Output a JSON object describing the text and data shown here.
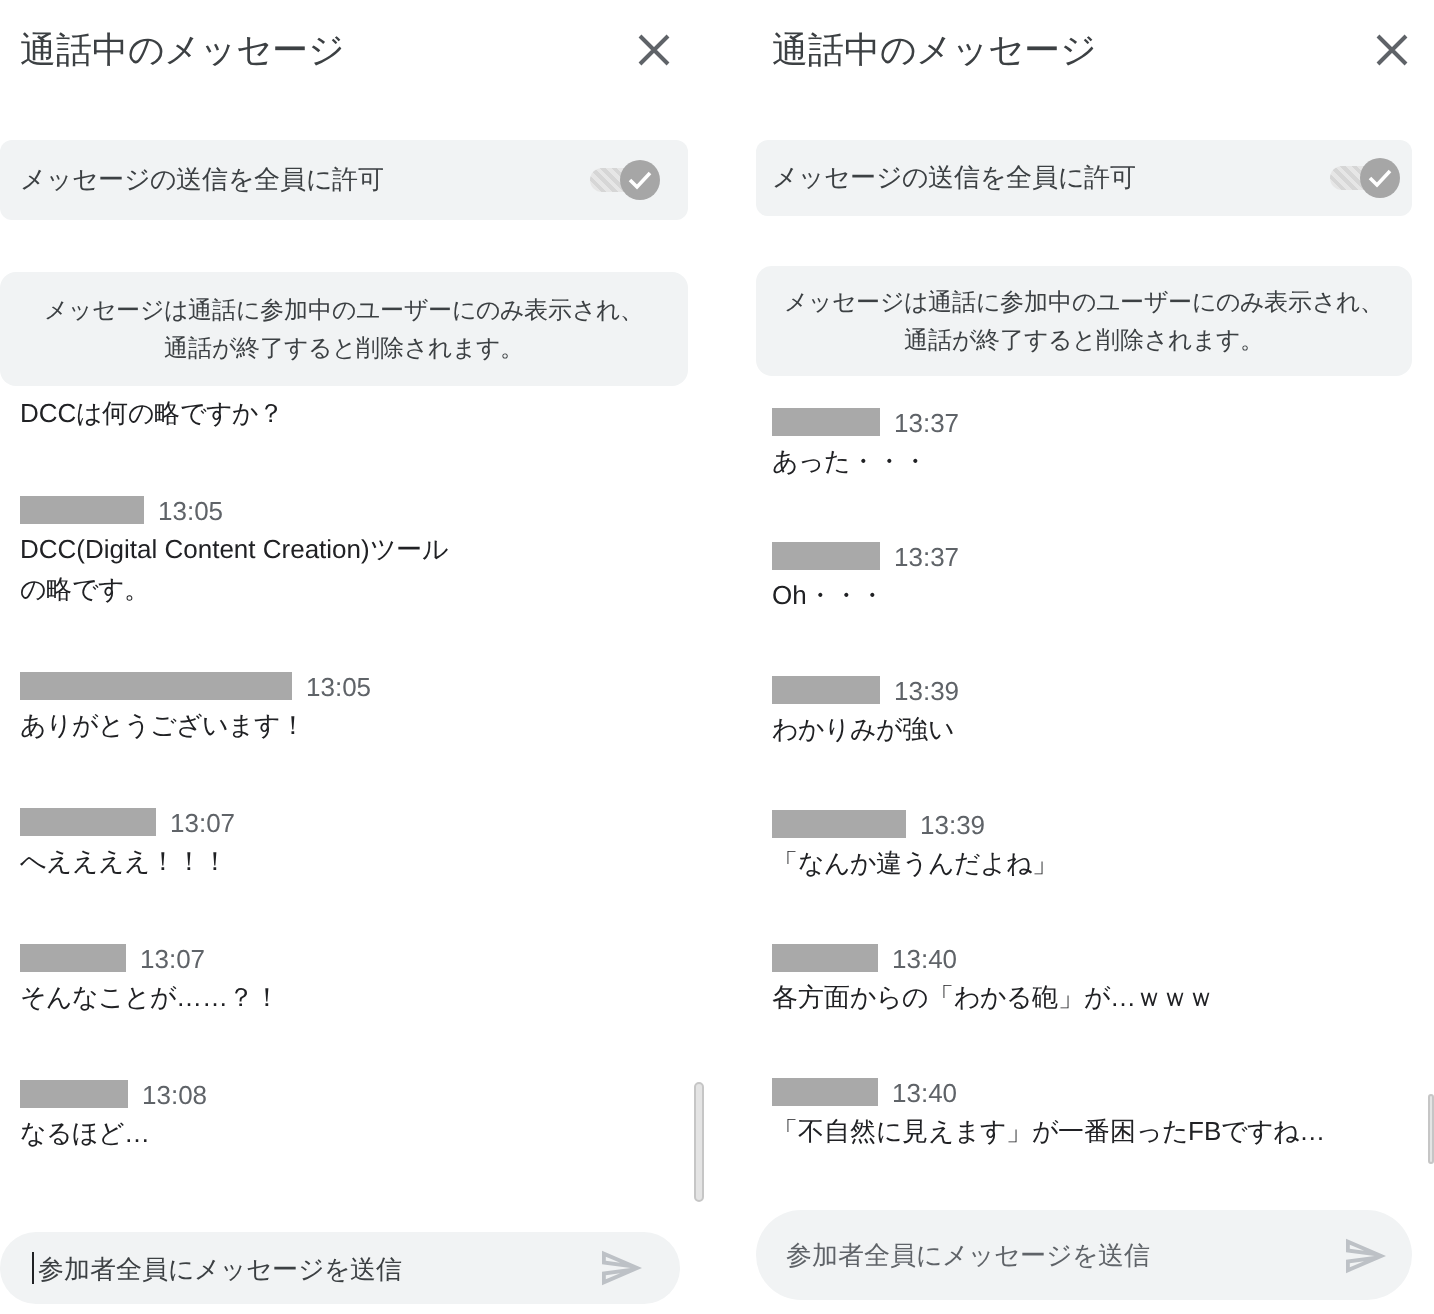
{
  "panels": [
    {
      "title": "通話中のメッセージ",
      "setting": {
        "label": "メッセージの送信を全員に許可",
        "on": true
      },
      "notice": "メッセージは通話に参加中のユーザーにのみ表示され、通話が終了すると削除されます。",
      "messages": [
        {
          "kind": "continued",
          "text": "DCCは何の略ですか？"
        },
        {
          "kind": "message",
          "time": "13:05",
          "text": "DCC(Digital Content Creation)ツールの略です。"
        },
        {
          "kind": "message",
          "time": "13:05",
          "text": "ありがとうございます！"
        },
        {
          "kind": "message",
          "time": "13:07",
          "text": "へええええ！！！"
        },
        {
          "kind": "message",
          "time": "13:07",
          "text": "そんなことが……？！"
        },
        {
          "kind": "message",
          "time": "13:08",
          "text": "なるほど…"
        }
      ],
      "composer": {
        "placeholder": "参加者全員にメッセージを送信",
        "focused": true
      }
    },
    {
      "title": "通話中のメッセージ",
      "setting": {
        "label": "メッセージの送信を全員に許可",
        "on": true
      },
      "notice": "メッセージは通話に参加中のユーザーにのみ表示され、通話が終了すると削除されます。",
      "messages": [
        {
          "kind": "message",
          "time": "13:37",
          "text": "あった・・・"
        },
        {
          "kind": "message",
          "time": "13:37",
          "text": "Oh・・・"
        },
        {
          "kind": "message",
          "time": "13:39",
          "text": "わかりみが強い"
        },
        {
          "kind": "message",
          "time": "13:39",
          "text": "「なんか違うんだよね」"
        },
        {
          "kind": "message",
          "time": "13:40",
          "text": "各方面からの「わかる砲」が…ｗｗｗ"
        },
        {
          "kind": "message",
          "time": "13:40",
          "text": "「不自然に見えます」が一番困ったFBですね…"
        }
      ],
      "composer": {
        "placeholder": "参加者全員にメッセージを送信",
        "focused": false
      }
    }
  ]
}
